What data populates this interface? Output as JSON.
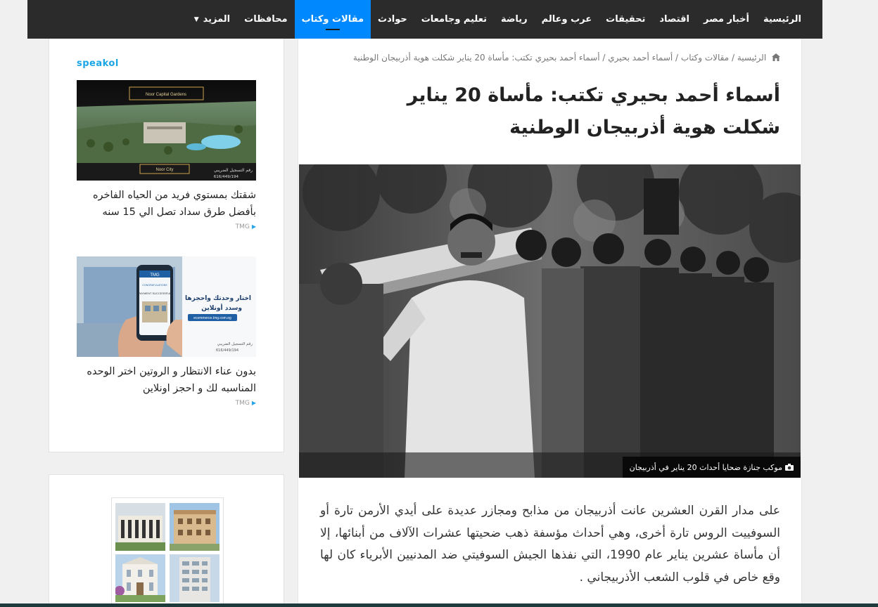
{
  "nav": {
    "items": [
      "الرئيسية",
      "أخبار مصر",
      "اقتصاد",
      "تحقيقات",
      "عرب وعالم",
      "رياضة",
      "تعليم وجامعات",
      "حوادث",
      "مقالات وكتاب",
      "محافظات",
      "المزيد"
    ],
    "active_index": 8,
    "active_color": "#0088ff"
  },
  "breadcrumb": {
    "home": "الرئيسية",
    "sep": "/",
    "category": "مقالات وكتاب",
    "author": "أسماء أحمد بحيري",
    "current": "أسماء أحمد بحيري تكتب: مأساة 20 يناير شكلت هوية أذربيجان الوطنية"
  },
  "article": {
    "title": "أسماء أحمد بحيري تكتب: مأساة 20 يناير شكلت هوية أذربيجان الوطنية",
    "photo_caption": "موكب جنازة ضحايا أحداث 20 يناير في أذربيجان",
    "body": "على مدار القرن العشرين عانت أذربيجان من مذابح ومجازر عديدة على أيدي الأرمن تارة أو السوفييت الروس تارة أخرى، وهي أحداث مؤسفة ذهب ضحيتها عشرات الآلاف من أبنائها، إلا أن مأساة عشرين يناير عام 1990، التي نفذها الجيش السوفيتي ضد المدنيين الأبرياء كان لها وقع خاص في قلوب الشعب الأذربيجاني ."
  },
  "sidebar": {
    "widget_brand": "speakol",
    "ads": [
      {
        "img_lines": [
          "Noor Capital Gardens",
          "Noor City",
          "رقم التسجيل الضريبي",
          "616/449/194"
        ],
        "title": "شقتك بمستوي فريد من الحياه الفاخره بأفضل طرق سداد تصل الي 15 سنه",
        "source": "TMG"
      },
      {
        "img_lines": [
          "TMG",
          "CONGRATULATIONS",
          "PAYMENT SUCCESSFUL",
          "اختار وحدتك واحجزها",
          "وسدد أونلاين",
          "ecommerce.tmg.com.eg",
          "رقم التسجيل الضريبي",
          "616/449/194"
        ],
        "title": "بدون عناء الانتظار و الروتين اختر الوحده المناسبه لك و احجز اونلاين",
        "source": "TMG"
      }
    ]
  }
}
